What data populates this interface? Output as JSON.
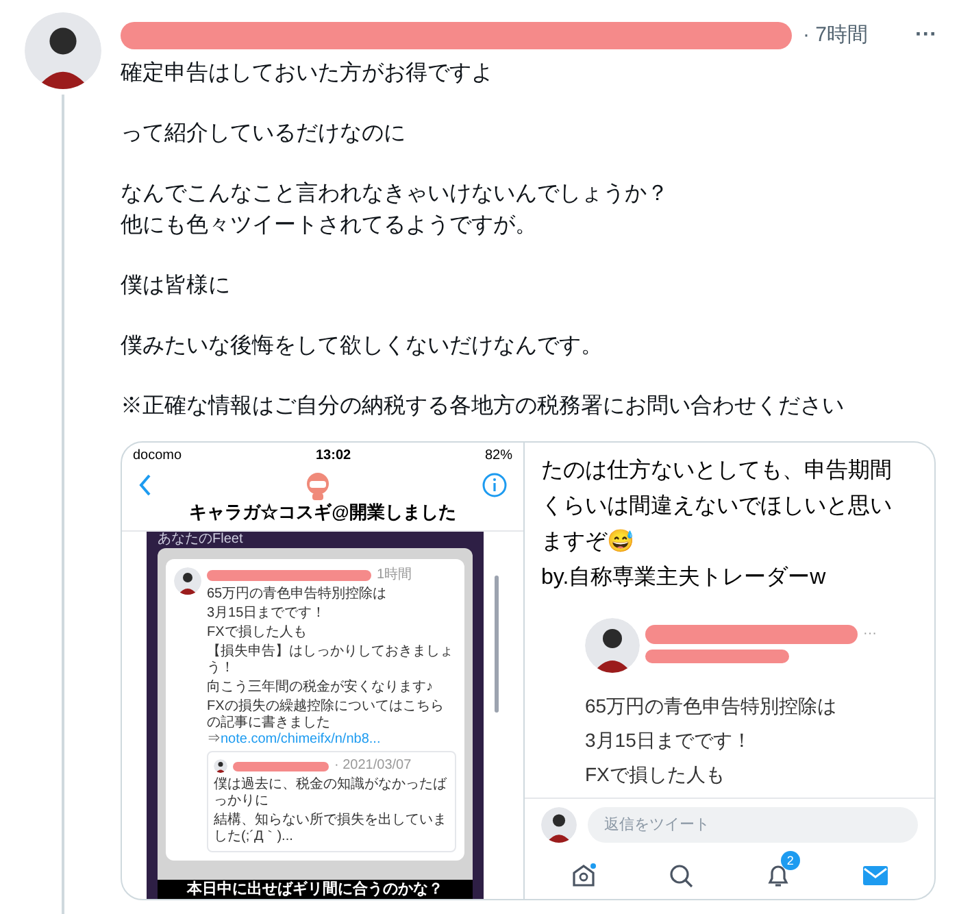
{
  "tweet": {
    "time": "· 7時間",
    "more": "···",
    "paragraphs": [
      [
        "確定申告はしておいた方がお得ですよ"
      ],
      [
        "って紹介しているだけなのに"
      ],
      [
        "なんでこんなこと言われなきゃいけないんでしょうか？",
        "他にも色々ツイートされてるようですが。"
      ],
      [
        "僕は皆様に"
      ],
      [
        "僕みたいな後悔をして欲しくないだけなんです。"
      ],
      [
        "※正確な情報はご自分の納税する各地方の税務署にお問い合わせください"
      ]
    ]
  },
  "left_image": {
    "status": {
      "carrier": "docomo",
      "time": "13:02",
      "battery": "82%"
    },
    "title": "キャラガ☆コスギ@開業しました",
    "fleet_label": "あなたのFleet",
    "card": {
      "time": "1時間",
      "lines": [
        "65万円の青色申告特別控除は",
        "3月15日までです！",
        "FXで損した人も",
        "【損失申告】はしっかりしておきましょう！",
        "向こう三年間の税金が安くなります♪"
      ],
      "link_text": "FXの損失の繰越控除についてはこちらの記事に書きました⇒",
      "link": "note.com/chimeifx/n/nb8...",
      "quote": {
        "date": "· 2021/03/07",
        "lines": [
          "僕は過去に、税金の知識がなかったばっかりに",
          "結構、知らない所で損失を出していました(;´Д｀)..."
        ]
      }
    },
    "caption": "本日中に出せばギリ間に合うのかな？"
  },
  "right_image": {
    "text_lines": [
      "たのは仕方ないとしても、申告期間",
      "くらいは間違えないでほしいと思い",
      "ますぞ😅",
      "by.自称専業主夫トレーダーw"
    ],
    "quoted": {
      "more": "···",
      "lines": [
        "65万円の青色申告特別控除は",
        "3月15日までです！",
        "FXで損した人も"
      ]
    },
    "reply_placeholder": "返信をツイート",
    "nav": {
      "badge": "2"
    }
  }
}
